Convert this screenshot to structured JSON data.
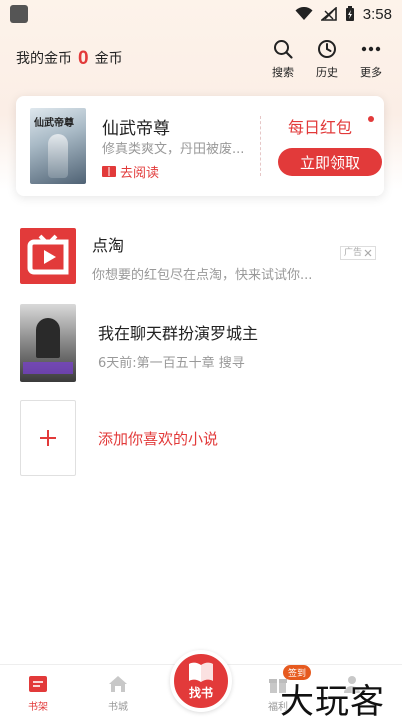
{
  "status_bar": {
    "time": "3:58"
  },
  "header": {
    "coins_label": "我的金币",
    "coins_value": "0",
    "coins_unit": "金币",
    "actions": [
      {
        "label": "搜索",
        "icon": "search-icon"
      },
      {
        "label": "历史",
        "icon": "history-icon"
      },
      {
        "label": "更多",
        "icon": "more-icon"
      }
    ]
  },
  "featured": {
    "title": "仙武帝尊",
    "description": "修真类爽文，丹田被废...",
    "read_label": "去阅读",
    "cover_text": "仙武帝尊",
    "daily_label": "每日红包",
    "claim_label": "立即领取"
  },
  "shelf": {
    "ad": {
      "title": "点淘",
      "subtitle": "你想要的红包尽在点淘，快来试试你...",
      "tag": "广告"
    },
    "book": {
      "title": "我在聊天群扮演罗城主",
      "subtitle": "6天前:第一百五十章 搜寻"
    },
    "add_label": "添加你喜欢的小说"
  },
  "bottom_nav": {
    "shelf": "书架",
    "store": "书城",
    "center": "找书",
    "welfare": "福利",
    "checkin_badge": "签到"
  },
  "watermark": "大玩客",
  "colors": {
    "accent": "#e23a3a"
  }
}
